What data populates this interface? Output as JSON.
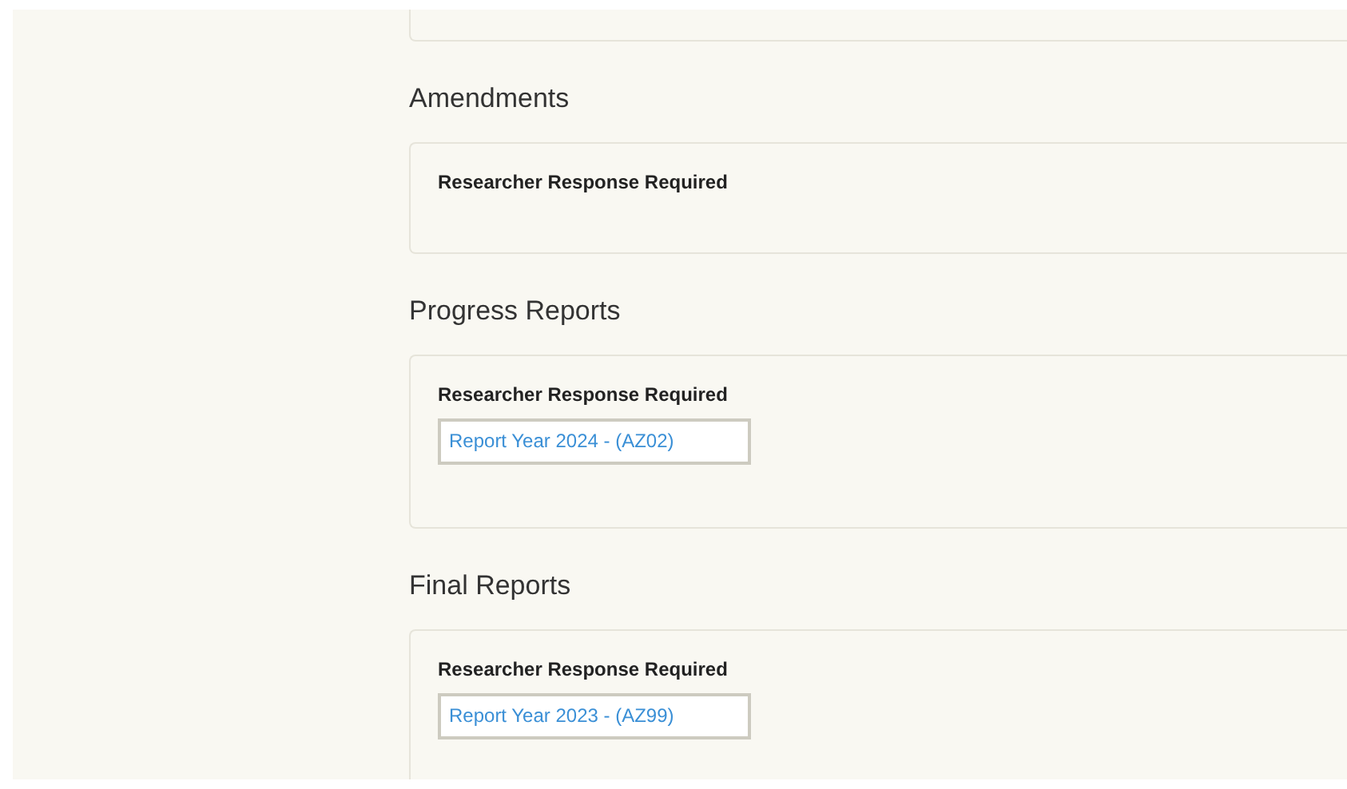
{
  "sections": [
    {
      "title": "Amendments",
      "card_label": "Researcher Response Required"
    },
    {
      "title": "Progress Reports",
      "card_label": "Researcher Response Required",
      "items": [
        "Report Year 2024 - (AZ02)"
      ]
    },
    {
      "title": "Final Reports",
      "card_label": "Researcher Response Required",
      "items": [
        "Report Year 2023 - (AZ99)"
      ]
    }
  ]
}
